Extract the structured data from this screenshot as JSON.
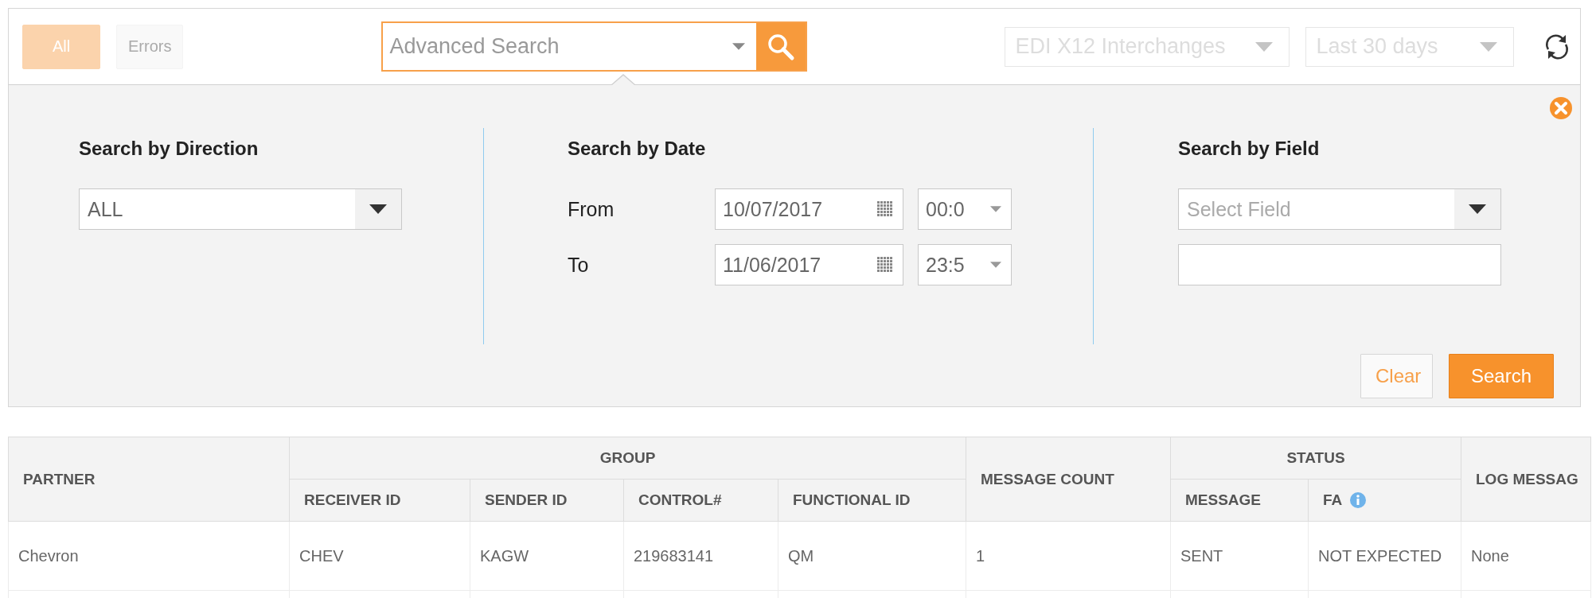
{
  "filter_tabs": [
    {
      "label": "All",
      "selected": true
    },
    {
      "label": "Errors",
      "selected": false
    }
  ],
  "search": {
    "placeholder": "Advanced Search"
  },
  "dropdowns": [
    {
      "value": "EDI X12 Interchanges",
      "disabled": true
    },
    {
      "value": "Last 30 days",
      "disabled": true
    }
  ],
  "panel": {
    "direction": {
      "heading": "Search by Direction",
      "value": "ALL"
    },
    "date": {
      "heading": "Search by Date",
      "rows": [
        {
          "label": "From",
          "date": "10/07/2017",
          "time": "00:0"
        },
        {
          "label": "To",
          "date": "11/06/2017",
          "time": "23:5"
        }
      ]
    },
    "field": {
      "heading": "Search by Field",
      "placeholder": "Select Field"
    },
    "buttons": [
      {
        "label": "Clear",
        "kind": "secondary"
      },
      {
        "label": "Search",
        "kind": "primary"
      }
    ]
  },
  "table": {
    "header_rows": [
      [
        {
          "label": "PARTNER",
          "rowspan": 2
        },
        {
          "label": "GROUP",
          "colspan": 4
        },
        {
          "label": "MESSAGE COUNT",
          "rowspan": 2
        },
        {
          "label": "STATUS",
          "colspan": 2
        },
        {
          "label": "LOG MESSAG",
          "rowspan": 2
        }
      ],
      [
        {
          "label": "RECEIVER ID"
        },
        {
          "label": "SENDER ID"
        },
        {
          "label": "CONTROL#"
        },
        {
          "label": "FUNCTIONAL ID"
        },
        {
          "label": "MESSAGE"
        },
        {
          "label": "FA",
          "info": true
        }
      ]
    ],
    "rows": [
      [
        "Chevron",
        "CHEV",
        "KAGW",
        "219683141",
        "QM",
        "1",
        "SENT",
        "NOT EXPECTED",
        "None"
      ]
    ]
  }
}
